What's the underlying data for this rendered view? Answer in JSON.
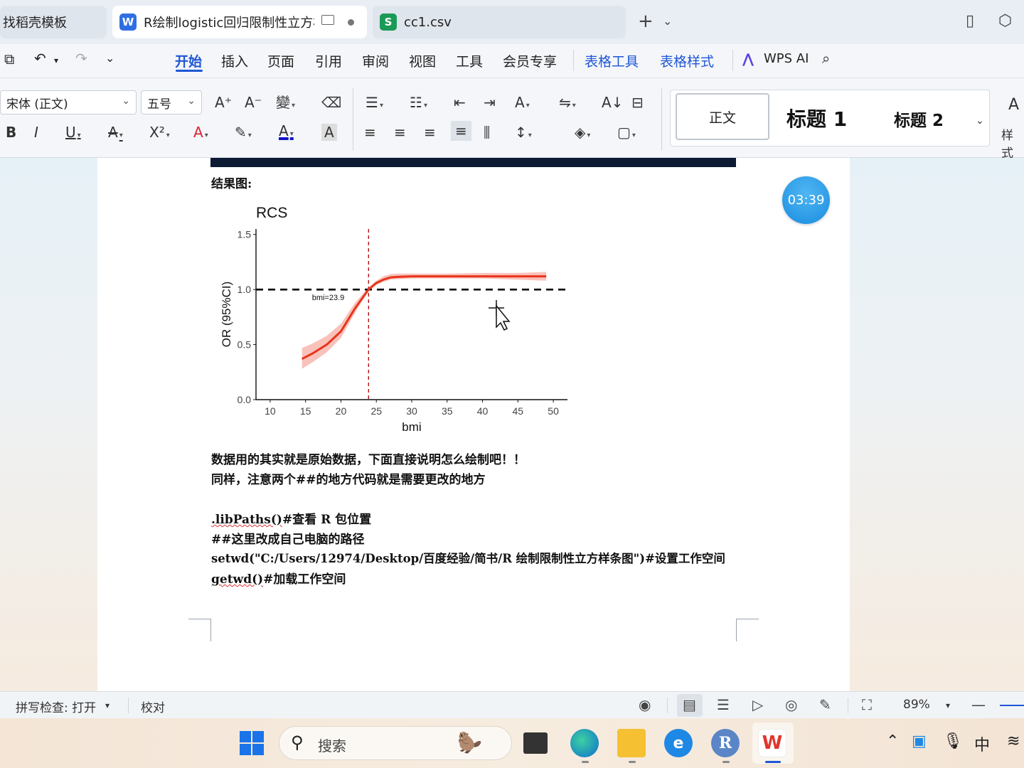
{
  "tabs": [
    {
      "title": "找稻壳模板"
    },
    {
      "icon_letter": "W",
      "title": "R绘制logistic回归限制性立方样条图",
      "icon_color": "#2f6ee3"
    },
    {
      "icon_letter": "S",
      "title": "cc1.csv",
      "icon_color": "#1a9a57"
    }
  ],
  "menu": {
    "items": [
      "开始",
      "插入",
      "页面",
      "引用",
      "审阅",
      "视图",
      "工具",
      "会员专享"
    ],
    "context_items": [
      "表格工具",
      "表格样式"
    ],
    "wps_ai": "WPS AI",
    "active": "开始"
  },
  "ribbon": {
    "font_name": "宋体 (正文)",
    "font_size": "五号",
    "styles": {
      "normal": "正文",
      "h1": "标题 1",
      "h2": "标题 2",
      "more_label": "样式"
    }
  },
  "document": {
    "heading": "结果图:",
    "paragraphs": [
      "数据用的其实就是原始数据，下面直接说明怎么绘制吧！！",
      "同样，注意两个##的地方代码就是需要更改的地方"
    ],
    "code_lines": [
      {
        "code": ".libPaths()",
        "comment": "#查看 R 包位置"
      },
      {
        "code": "",
        "comment": "##这里改成自己电脑的路径"
      },
      {
        "code": "setwd(\"C:/Users/12974/Desktop/百度经验/简书/R 绘制限制性立方样条图\")",
        "comment": "#设置工作空间"
      },
      {
        "code": "getwd()",
        "comment": "#加载工作空间"
      }
    ],
    "timer": "03:39"
  },
  "chart_data": {
    "type": "line",
    "title": "RCS",
    "xlabel": "bmi",
    "ylabel": "OR (95%CI)",
    "xlim": [
      8,
      52
    ],
    "ylim": [
      0,
      1.55
    ],
    "xticks": [
      10,
      15,
      20,
      25,
      30,
      35,
      40,
      45,
      50
    ],
    "yticks": [
      0.0,
      0.5,
      1.0,
      1.5
    ],
    "ytick_labels": [
      "0.0",
      "0.5",
      "1.0",
      "1.5"
    ],
    "reference_line": {
      "y": 1.0,
      "style": "dashed",
      "color": "#000000"
    },
    "vertical_line": {
      "x": 23.9,
      "style": "dashed",
      "color": "#b00000",
      "label": "bmi=23.9"
    },
    "series": [
      {
        "color": "#e8351c",
        "x": [
          14.5,
          16,
          18,
          20,
          22,
          23.9,
          25,
          26,
          27,
          28,
          30,
          35,
          40,
          45,
          49
        ],
        "y": [
          0.37,
          0.42,
          0.5,
          0.62,
          0.83,
          1.0,
          1.06,
          1.09,
          1.11,
          1.115,
          1.12,
          1.12,
          1.12,
          1.12,
          1.12
        ],
        "lower": [
          0.28,
          0.34,
          0.43,
          0.56,
          0.79,
          0.99,
          1.04,
          1.07,
          1.09,
          1.095,
          1.1,
          1.1,
          1.1,
          1.09,
          1.08
        ],
        "upper": [
          0.47,
          0.51,
          0.58,
          0.69,
          0.88,
          1.02,
          1.08,
          1.12,
          1.14,
          1.145,
          1.145,
          1.145,
          1.15,
          1.15,
          1.16
        ]
      }
    ],
    "grid": false
  },
  "statusbar": {
    "spell_check": "拼写检查: 打开",
    "proofread": "校对",
    "zoom": "89%"
  },
  "taskbar": {
    "search_placeholder": "搜索",
    "ime": "中"
  },
  "colors": {
    "accent": "#1f56d6",
    "wps_red": "#e0362d"
  }
}
